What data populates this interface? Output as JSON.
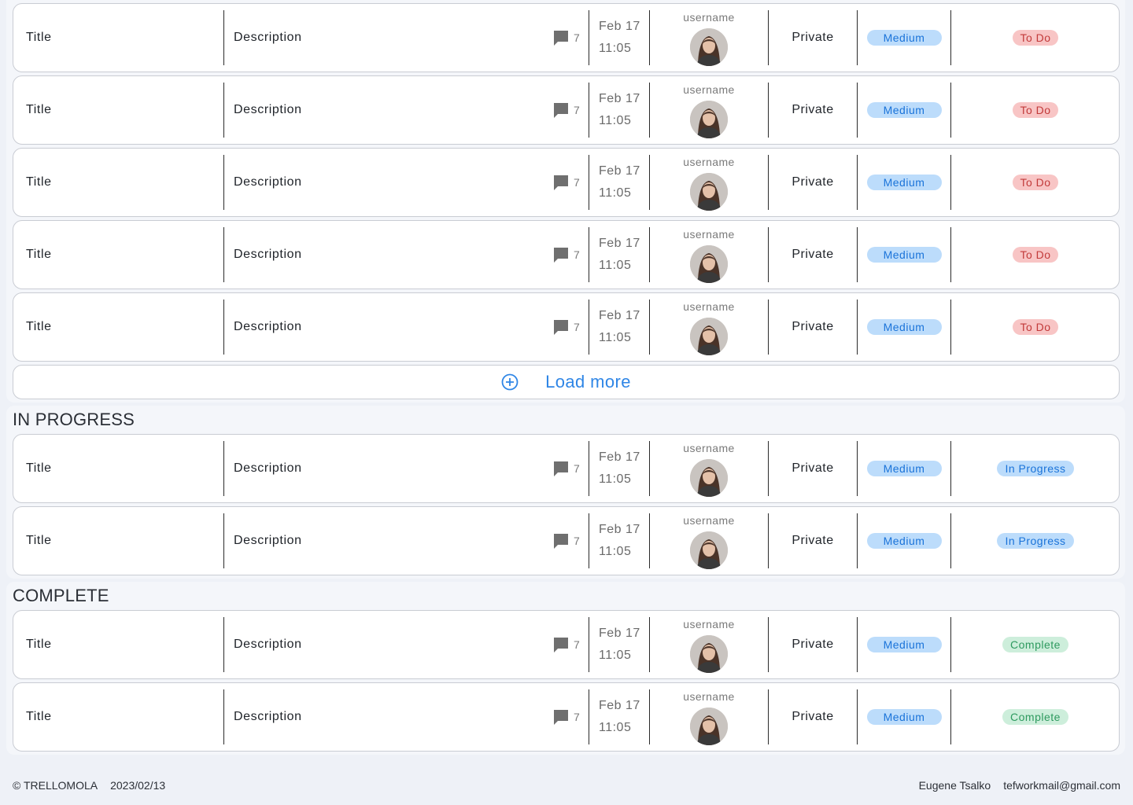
{
  "colors": {
    "page_bg": "#eef1f7",
    "section_bg": "#f4f6fa",
    "accent": "#2f86e6",
    "priority_medium": "#1a73d9",
    "status_todo": "#c23a3a",
    "status_in_progress": "#1a73d9",
    "status_complete": "#2e9a5f"
  },
  "load_more": {
    "label": "Load more",
    "icon": "plus-circle-icon"
  },
  "sections": {
    "in_progress": {
      "title": "IN PROGRESS"
    },
    "complete": {
      "title": "COMPLETE"
    }
  },
  "task": {
    "title": "Title",
    "description": "Description",
    "comments_icon": "comment-icon",
    "comments": "7",
    "date": "Feb 17",
    "time": "11:05",
    "username": "username",
    "visibility": "Private",
    "priority": "Medium"
  },
  "status": {
    "todo": "To Do",
    "in_progress": "In Progress",
    "complete": "Complete"
  },
  "footer": {
    "copyright": "© TRELLOMOLA",
    "date": "2023/02/13",
    "author": "Eugene Tsalko",
    "email": "tefworkmail@gmail.com"
  }
}
